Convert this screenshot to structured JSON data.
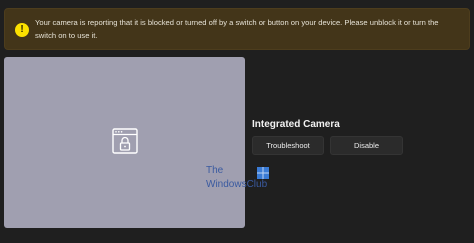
{
  "banner": {
    "icon": "warning-icon",
    "message": "Your camera is reporting that it is blocked or turned off by a switch or button on your device. Please unblock it or turn the switch on to use it."
  },
  "preview": {
    "icon": "camera-blocked-lock-icon"
  },
  "camera": {
    "name": "Integrated Camera",
    "troubleshoot_label": "Troubleshoot",
    "disable_label": "Disable"
  },
  "watermark": {
    "line1": "The",
    "line2": "WindowsClub"
  },
  "colors": {
    "banner_bg": "#433519",
    "warning_icon": "#fce100",
    "preview_bg": "#a09fb0",
    "page_bg": "#1f1f1f",
    "button_bg": "#2b2b2b"
  }
}
